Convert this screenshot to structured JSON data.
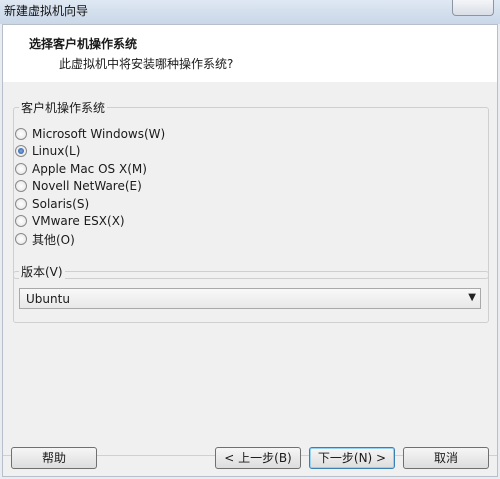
{
  "window": {
    "title": "新建虚拟机向导",
    "close_icon": "close-icon"
  },
  "header": {
    "title": "选择客户机操作系统",
    "subtitle": "此虚拟机中将安装哪种操作系统?"
  },
  "os_group": {
    "label": "客户机操作系统",
    "options": [
      {
        "label": "Microsoft Windows(W)",
        "checked": false
      },
      {
        "label": "Linux(L)",
        "checked": true
      },
      {
        "label": "Apple Mac OS X(M)",
        "checked": false
      },
      {
        "label": "Novell NetWare(E)",
        "checked": false
      },
      {
        "label": "Solaris(S)",
        "checked": false
      },
      {
        "label": "VMware ESX(X)",
        "checked": false
      },
      {
        "label": "其他(O)",
        "checked": false
      }
    ]
  },
  "version_group": {
    "label": "版本(V)",
    "selected": "Ubuntu"
  },
  "buttons": {
    "help": "帮助",
    "back": "< 上一步(B)",
    "next": "下一步(N) >",
    "cancel": "取消"
  },
  "colors": {
    "selected_radio": "#1d4f9a",
    "default_button_border": "#3c7fb1"
  }
}
